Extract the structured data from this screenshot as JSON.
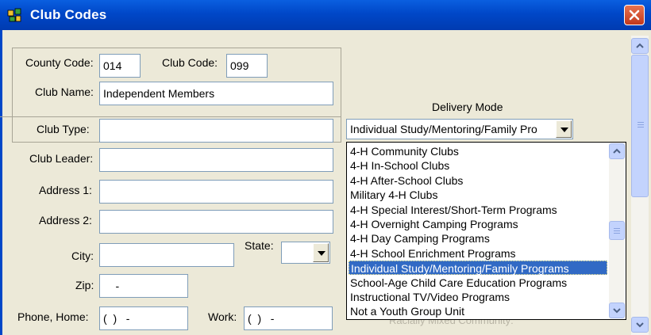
{
  "window": {
    "title": "Club Codes",
    "close_label": "close"
  },
  "form": {
    "county_code": {
      "label": "County Code:",
      "value": "014"
    },
    "club_code": {
      "label": "Club Code:",
      "value": "099"
    },
    "club_name": {
      "label": "Club Name:",
      "value": "Independent Members"
    },
    "club_type": {
      "label": "Club Type:",
      "value": ""
    },
    "club_leader": {
      "label": "Club Leader:",
      "value": ""
    },
    "address1": {
      "label": "Address 1:",
      "value": ""
    },
    "address2": {
      "label": "Address 2:",
      "value": ""
    },
    "city": {
      "label": "City:",
      "value": ""
    },
    "state": {
      "label": "State:",
      "value": ""
    },
    "zip": {
      "label": "Zip:",
      "value": "    -"
    },
    "phone_home": {
      "label": "Phone, Home:",
      "value": "(  )   -"
    },
    "work": {
      "label": "Work:",
      "value": "(  )   -"
    }
  },
  "delivery_mode": {
    "label": "Delivery Mode",
    "selected": "Individual Study/Mentoring/Family Pro",
    "options": [
      "4-H Community Clubs",
      "4-H In-School Clubs",
      "4-H After-School Clubs",
      "Military 4-H Clubs",
      "4-H Special Interest/Short-Term Programs",
      "4-H Overnight Camping Programs",
      "4-H Day Camping Programs",
      "4-H School Enrichment Programs",
      "Individual Study/Mentoring/Family Programs",
      "School-Age Child Care Education Programs",
      "Instructional TV/Video Programs",
      "Not a Youth Group Unit"
    ],
    "selected_index": 8
  },
  "hidden_text": "Racially Mixed Community:",
  "colors": {
    "titlebar": "#0047c8",
    "selection": "#316ac5",
    "background": "#ece9d8"
  }
}
